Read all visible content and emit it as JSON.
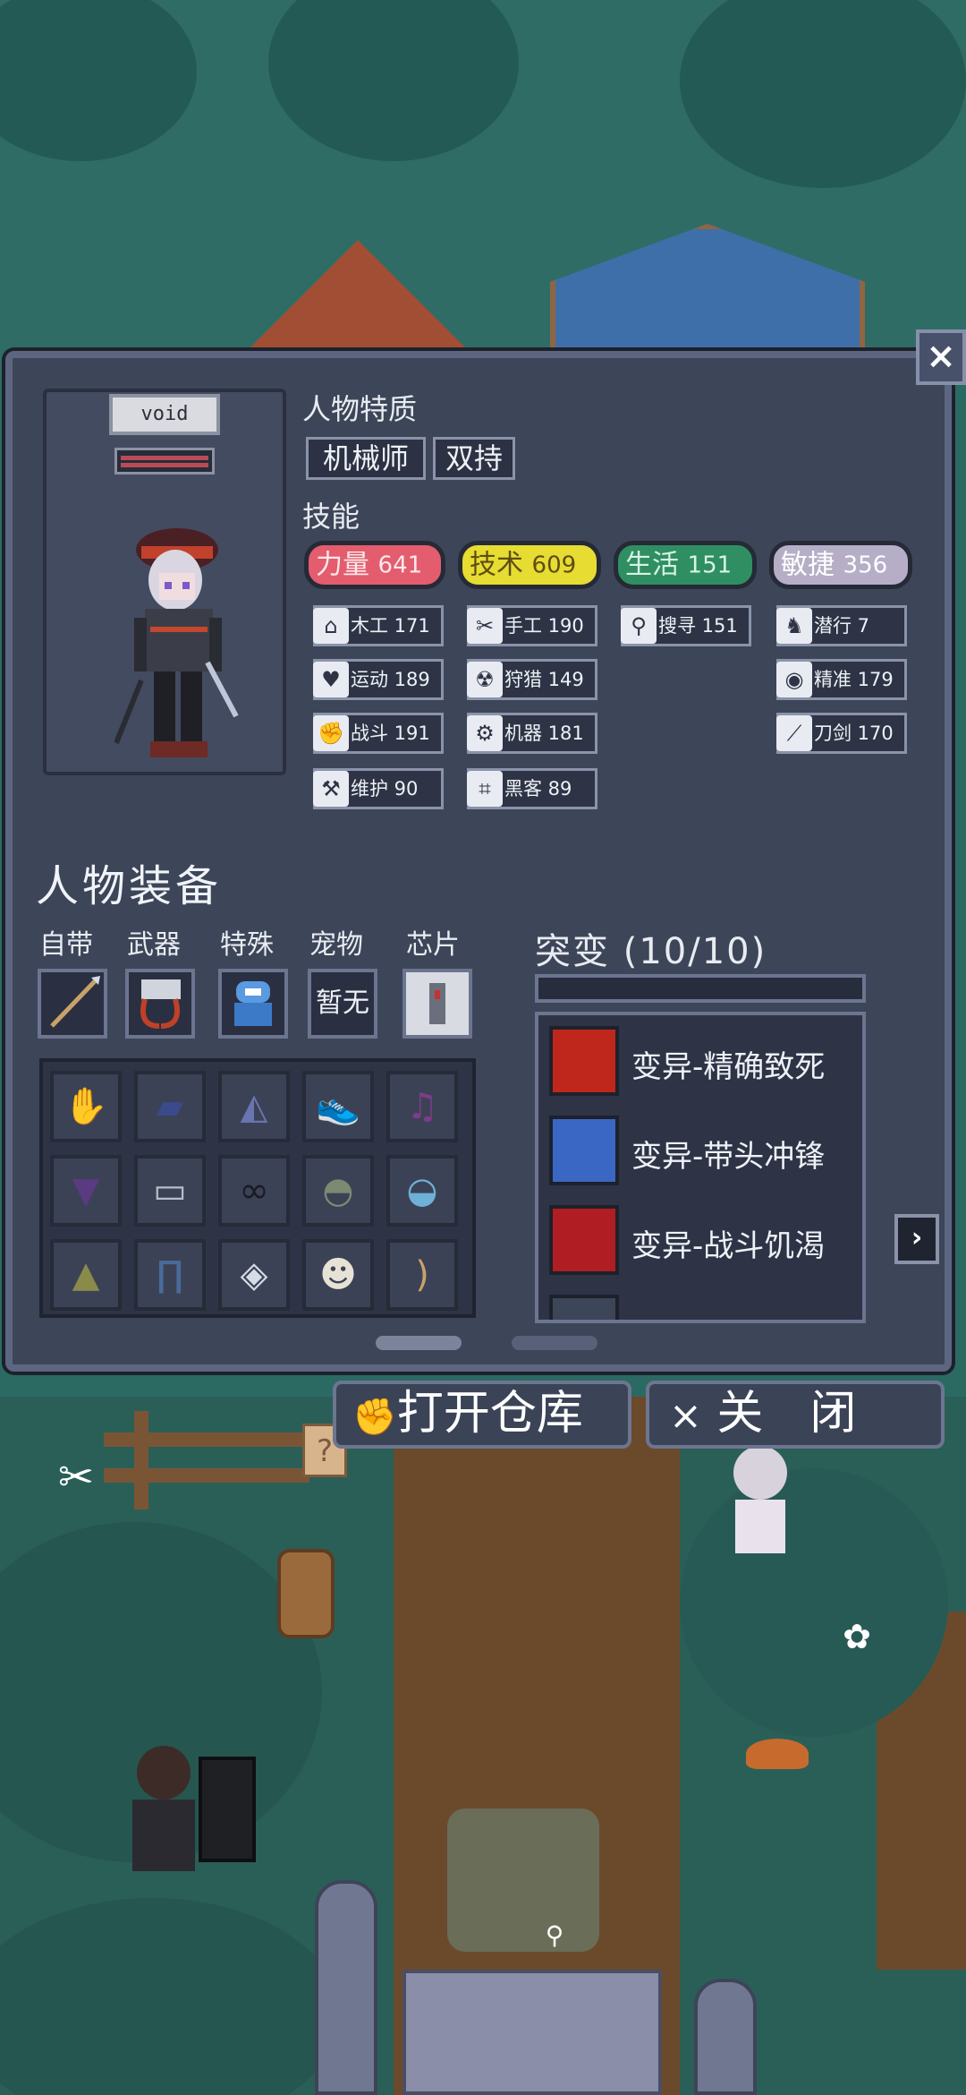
{
  "character": {
    "name": "void",
    "traits_label": "人物特质",
    "traits": [
      "机械师",
      "双持"
    ],
    "skills_label": "技能"
  },
  "stats": [
    {
      "label": "力量",
      "value": "641",
      "color": "#e35d6e"
    },
    {
      "label": "技术",
      "value": "609",
      "color": "#e6dc32"
    },
    {
      "label": "生活",
      "value": "151",
      "color": "#2f8f62"
    },
    {
      "label": "敏捷",
      "value": "356",
      "color": "#b6aec6"
    }
  ],
  "skills": {
    "col1": [
      {
        "icon": "house-icon",
        "glyph": "⌂",
        "text": "木工 171"
      },
      {
        "icon": "heart-icon",
        "glyph": "♥",
        "text": "运动 189"
      },
      {
        "icon": "fist-icon",
        "glyph": "✊",
        "text": "战斗 191"
      },
      {
        "icon": "wrench-icon",
        "glyph": "⚒",
        "text": "维护 90"
      }
    ],
    "col2": [
      {
        "icon": "scissors-icon",
        "glyph": "✂",
        "text": "手工 190"
      },
      {
        "icon": "radiation-icon",
        "glyph": "☢",
        "text": "狩猎 149"
      },
      {
        "icon": "gear-icon",
        "glyph": "⚙",
        "text": "机器 181"
      },
      {
        "icon": "circuit-icon",
        "glyph": "⌗",
        "text": "黑客 89"
      }
    ],
    "col3": [
      {
        "icon": "magnifier-icon",
        "glyph": "⚲",
        "text": "搜寻 151"
      }
    ],
    "col4": [
      {
        "icon": "sneak-icon",
        "glyph": "♞",
        "text": "潜行 7"
      },
      {
        "icon": "eye-icon",
        "glyph": "◉",
        "text": "精准 179"
      },
      {
        "icon": "sword-icon",
        "glyph": "⟋",
        "text": "刀剑 170"
      }
    ]
  },
  "equipment": {
    "title": "人物装备",
    "slot_labels": [
      "自带",
      "武器",
      "特殊",
      "宠物",
      "芯片"
    ],
    "pet_slot_text": "暂无"
  },
  "mutation": {
    "title": "突变 (10/10)",
    "items": [
      {
        "name": "变异-精确致死",
        "icon_color": "#c0271c"
      },
      {
        "name": "变异-带头冲锋",
        "icon_color": "#3a67c4"
      },
      {
        "name": "变异-战斗饥渴",
        "icon_color": "#b01e24"
      }
    ]
  },
  "buttons": {
    "open_storage": "打开仓库",
    "close": "关　闭",
    "close_symbol": "×",
    "top_close": "×"
  }
}
